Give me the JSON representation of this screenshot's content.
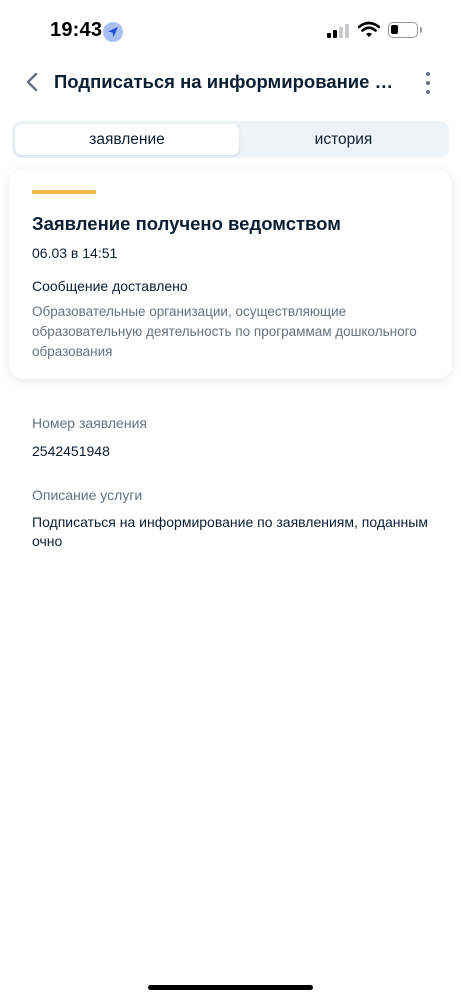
{
  "status_bar": {
    "time": "19:43",
    "location_icon": "location-arrow-icon",
    "signal_icon": "cellular-signal-icon",
    "wifi_icon": "wifi-icon",
    "battery_icon": "battery-icon"
  },
  "header": {
    "back_icon": "chevron-left-icon",
    "title": "Подписаться на информирование по...",
    "more_icon": "more-vertical-icon"
  },
  "tabs": [
    {
      "label": "заявление",
      "active": true
    },
    {
      "label": "история",
      "active": false
    }
  ],
  "status_card": {
    "accent_color": "#f1bb49",
    "title": "Заявление получено ведомством",
    "datetime": "06.03 в 14:51",
    "message": "Сообщение доставлено",
    "organization": "Образовательные организации, осуществляющие образовательную деятельность по программам дошкольного образования"
  },
  "details": {
    "number_label": "Номер заявления",
    "number_value": "2542451948",
    "service_label": "Описание услуги",
    "service_value": "Подписаться на информирование по заявлениям, поданным очно"
  },
  "colors": {
    "primary_text": "#0b1f33",
    "secondary_text": "#66727f",
    "tab_background": "#eef3f9",
    "accent": "#f1bb49"
  }
}
